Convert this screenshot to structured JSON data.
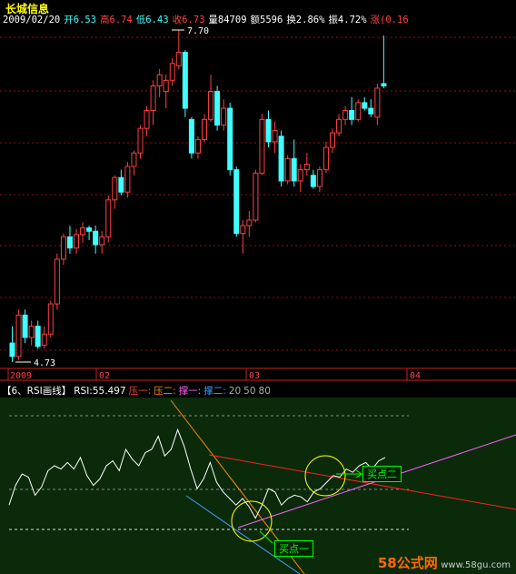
{
  "stock_name": "长城信息",
  "quote": {
    "date": "2009/02/20",
    "open": "开6.53",
    "high": "高6.74",
    "low": "低6.43",
    "close": "收6.73",
    "volume": "量84709",
    "amount": "额5596",
    "turnover": "换2.86%",
    "amplitude": "振4.72%",
    "change": "涨(0.16"
  },
  "price_axis": {
    "high_label": "7.70",
    "low_label": "4.73"
  },
  "time_axis": [
    "2009",
    "02",
    "03",
    "04"
  ],
  "rsi_panel": {
    "title": "【6、RSI画线】",
    "value": "RSI:55.497",
    "pressure_1": "压一:",
    "pressure_2": "压二:",
    "support_1": "撑一:",
    "support_2": "撑二:",
    "level_20": "20",
    "level_50": "50",
    "level_80": "80",
    "buy_point_1": "买点一",
    "buy_point_2": "买点二"
  },
  "watermark": {
    "brand": "58公式网",
    "url": "www.58gu.com"
  },
  "colors": {
    "up": "#ff4040",
    "down": "#40ffff",
    "bg": "#000000",
    "rsi_bg": "#0a2a0a",
    "grid": "#8b1010"
  },
  "chart_data": [
    {
      "type": "candlestick",
      "title": "长城信息",
      "ylim": [
        4.5,
        7.9
      ],
      "candles": [
        {
          "o": 4.9,
          "h": 5.05,
          "l": 4.73,
          "c": 4.78
        },
        {
          "o": 4.78,
          "h": 5.2,
          "l": 4.75,
          "c": 5.15
        },
        {
          "o": 5.15,
          "h": 5.2,
          "l": 4.9,
          "c": 4.95
        },
        {
          "o": 4.95,
          "h": 5.1,
          "l": 4.88,
          "c": 5.05
        },
        {
          "o": 5.05,
          "h": 5.1,
          "l": 4.85,
          "c": 4.87
        },
        {
          "o": 4.88,
          "h": 5.05,
          "l": 4.85,
          "c": 4.98
        },
        {
          "o": 4.98,
          "h": 5.28,
          "l": 4.95,
          "c": 5.25
        },
        {
          "o": 5.25,
          "h": 5.7,
          "l": 5.2,
          "c": 5.65
        },
        {
          "o": 5.65,
          "h": 5.88,
          "l": 5.6,
          "c": 5.85
        },
        {
          "o": 5.85,
          "h": 5.95,
          "l": 5.7,
          "c": 5.75
        },
        {
          "o": 5.75,
          "h": 5.92,
          "l": 5.7,
          "c": 5.87
        },
        {
          "o": 5.87,
          "h": 5.98,
          "l": 5.8,
          "c": 5.93
        },
        {
          "o": 5.93,
          "h": 5.95,
          "l": 5.82,
          "c": 5.9
        },
        {
          "o": 5.9,
          "h": 5.95,
          "l": 5.7,
          "c": 5.78
        },
        {
          "o": 5.78,
          "h": 5.9,
          "l": 5.7,
          "c": 5.85
        },
        {
          "o": 5.85,
          "h": 6.22,
          "l": 5.8,
          "c": 6.18
        },
        {
          "o": 6.18,
          "h": 6.4,
          "l": 6.1,
          "c": 6.38
        },
        {
          "o": 6.38,
          "h": 6.45,
          "l": 6.22,
          "c": 6.25
        },
        {
          "o": 6.25,
          "h": 6.52,
          "l": 6.2,
          "c": 6.48
        },
        {
          "o": 6.48,
          "h": 6.62,
          "l": 6.4,
          "c": 6.6
        },
        {
          "o": 6.6,
          "h": 6.85,
          "l": 6.55,
          "c": 6.82
        },
        {
          "o": 6.82,
          "h": 7.02,
          "l": 6.75,
          "c": 6.98
        },
        {
          "o": 6.98,
          "h": 7.25,
          "l": 6.85,
          "c": 7.2
        },
        {
          "o": 7.2,
          "h": 7.35,
          "l": 7.1,
          "c": 7.3
        },
        {
          "o": 7.15,
          "h": 7.3,
          "l": 7.0,
          "c": 7.25
        },
        {
          "o": 7.25,
          "h": 7.45,
          "l": 7.2,
          "c": 7.4
        },
        {
          "o": 7.38,
          "h": 7.7,
          "l": 7.35,
          "c": 7.5
        },
        {
          "o": 7.5,
          "h": 7.52,
          "l": 6.92,
          "c": 7.0
        },
        {
          "o": 6.9,
          "h": 6.92,
          "l": 6.55,
          "c": 6.6
        },
        {
          "o": 6.6,
          "h": 6.75,
          "l": 6.55,
          "c": 6.72
        },
        {
          "o": 6.72,
          "h": 6.95,
          "l": 6.7,
          "c": 6.9
        },
        {
          "o": 6.9,
          "h": 7.3,
          "l": 6.88,
          "c": 7.15
        },
        {
          "o": 7.15,
          "h": 7.2,
          "l": 6.8,
          "c": 6.85
        },
        {
          "o": 6.85,
          "h": 7.08,
          "l": 6.8,
          "c": 7.0
        },
        {
          "o": 7.0,
          "h": 7.05,
          "l": 6.4,
          "c": 6.45
        },
        {
          "o": 6.45,
          "h": 6.48,
          "l": 5.85,
          "c": 5.88
        },
        {
          "o": 5.88,
          "h": 6.0,
          "l": 5.7,
          "c": 5.95
        },
        {
          "o": 5.95,
          "h": 6.08,
          "l": 5.85,
          "c": 6.0
        },
        {
          "o": 6.0,
          "h": 6.45,
          "l": 5.98,
          "c": 6.42
        },
        {
          "o": 6.42,
          "h": 6.95,
          "l": 6.4,
          "c": 6.9
        },
        {
          "o": 6.9,
          "h": 6.98,
          "l": 6.65,
          "c": 6.7
        },
        {
          "o": 6.7,
          "h": 6.88,
          "l": 6.6,
          "c": 6.8
        },
        {
          "o": 6.75,
          "h": 6.8,
          "l": 6.3,
          "c": 6.35
        },
        {
          "o": 6.35,
          "h": 6.58,
          "l": 6.32,
          "c": 6.55
        },
        {
          "o": 6.55,
          "h": 6.72,
          "l": 6.3,
          "c": 6.35
        },
        {
          "o": 6.35,
          "h": 6.5,
          "l": 6.25,
          "c": 6.45
        },
        {
          "o": 6.45,
          "h": 6.6,
          "l": 6.4,
          "c": 6.5
        },
        {
          "o": 6.4,
          "h": 6.45,
          "l": 6.28,
          "c": 6.3
        },
        {
          "o": 6.3,
          "h": 6.48,
          "l": 6.25,
          "c": 6.45
        },
        {
          "o": 6.45,
          "h": 6.7,
          "l": 6.42,
          "c": 6.65
        },
        {
          "o": 6.65,
          "h": 6.82,
          "l": 6.6,
          "c": 6.78
        },
        {
          "o": 6.78,
          "h": 6.95,
          "l": 6.75,
          "c": 6.9
        },
        {
          "o": 6.9,
          "h": 7.02,
          "l": 6.85,
          "c": 6.98
        },
        {
          "o": 6.98,
          "h": 7.1,
          "l": 6.85,
          "c": 6.9
        },
        {
          "o": 6.9,
          "h": 7.08,
          "l": 6.88,
          "c": 7.05
        },
        {
          "o": 7.05,
          "h": 7.1,
          "l": 6.98,
          "c": 7.0
        },
        {
          "o": 7.0,
          "h": 7.08,
          "l": 6.92,
          "c": 6.95
        },
        {
          "o": 6.92,
          "h": 7.22,
          "l": 6.85,
          "c": 7.18
        },
        {
          "o": 7.22,
          "h": 7.65,
          "l": 7.18,
          "c": 7.2
        }
      ]
    },
    {
      "type": "line",
      "title": "RSI",
      "ylim": [
        0,
        100
      ],
      "values": [
        36,
        48,
        55,
        53,
        42,
        47,
        57,
        60,
        58,
        62,
        58,
        65,
        54,
        48,
        52,
        60,
        63,
        57,
        70,
        64,
        60,
        68,
        70,
        78,
        66,
        70,
        82,
        72,
        58,
        46,
        52,
        62,
        50,
        44,
        40,
        36,
        40,
        35,
        28,
        36,
        46,
        44,
        36,
        40,
        42,
        41,
        38,
        44,
        46,
        50,
        54,
        53,
        58,
        56,
        60,
        62,
        58,
        63,
        65
      ]
    }
  ]
}
